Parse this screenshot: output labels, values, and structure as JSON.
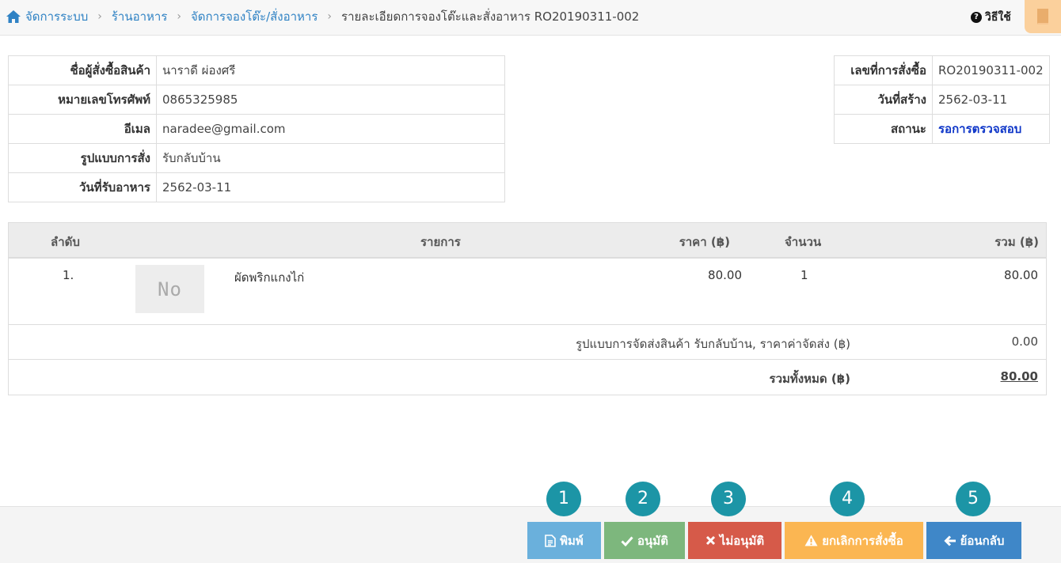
{
  "breadcrumb": {
    "items": [
      "จัดการระบบ",
      "ร้านอาหาร",
      "จัดการจองโต๊ะ/สั่งอาหาร"
    ],
    "current": "รายละเอียดการจองโต๊ะและสั่งอาหาร RO20190311-002"
  },
  "header": {
    "help_label": "วิธีใช้"
  },
  "customer": {
    "name_label": "ชื่อผู้สั่งซื้อสินค้า",
    "name": "นาราดี ผ่องศรี",
    "phone_label": "หมายเลขโทรศัพท์",
    "phone": "0865325985",
    "email_label": "อีเมล",
    "email": "naradee@gmail.com",
    "type_label": "รูปแบบการสั่ง",
    "type": "รับกลับบ้าน",
    "date_label": "วันที่รับอาหาร",
    "date": "2562-03-11"
  },
  "order": {
    "no_label": "เลขที่การสั่งซื้อ",
    "no": "RO20190311-002",
    "created_label": "วันที่สร้าง",
    "created": "2562-03-11",
    "status_label": "สถานะ",
    "status": "รอการตรวจสอบ"
  },
  "items_table": {
    "headers": [
      "ลำดับ",
      "รายการ",
      "ราคา (฿)",
      "จำนวน",
      "รวม (฿)"
    ],
    "rows": [
      {
        "no": "1.",
        "image_text": "No",
        "name": "ผัดพริกแกงไก่",
        "price": "80.00",
        "qty": "1",
        "total": "80.00"
      }
    ],
    "shipping_label": "รูปแบบการจัดส่งสินค้า รับกลับบ้าน,  ราคาค่าจัดส่ง (฿)",
    "shipping_value": "0.00",
    "grand_label": "รวมทั้งหมด (฿)",
    "grand_value": "80.00"
  },
  "actions": {
    "print": "พิมพ์",
    "approve": "อนุมัติ",
    "reject": "ไม่อนุมัติ",
    "cancel": "ยกเลิกการสั่งซื้อ",
    "back": "ย้อนกลับ"
  },
  "badges": [
    "1",
    "2",
    "3",
    "4",
    "5"
  ],
  "colors": {
    "link": "#2f82c4",
    "status": "#0d35c8",
    "print": "#6ab0dc",
    "approve": "#7db77d",
    "reject": "#d65a49",
    "cancel": "#fbb652",
    "back": "#3f87c8",
    "badge": "#1c95a6"
  }
}
